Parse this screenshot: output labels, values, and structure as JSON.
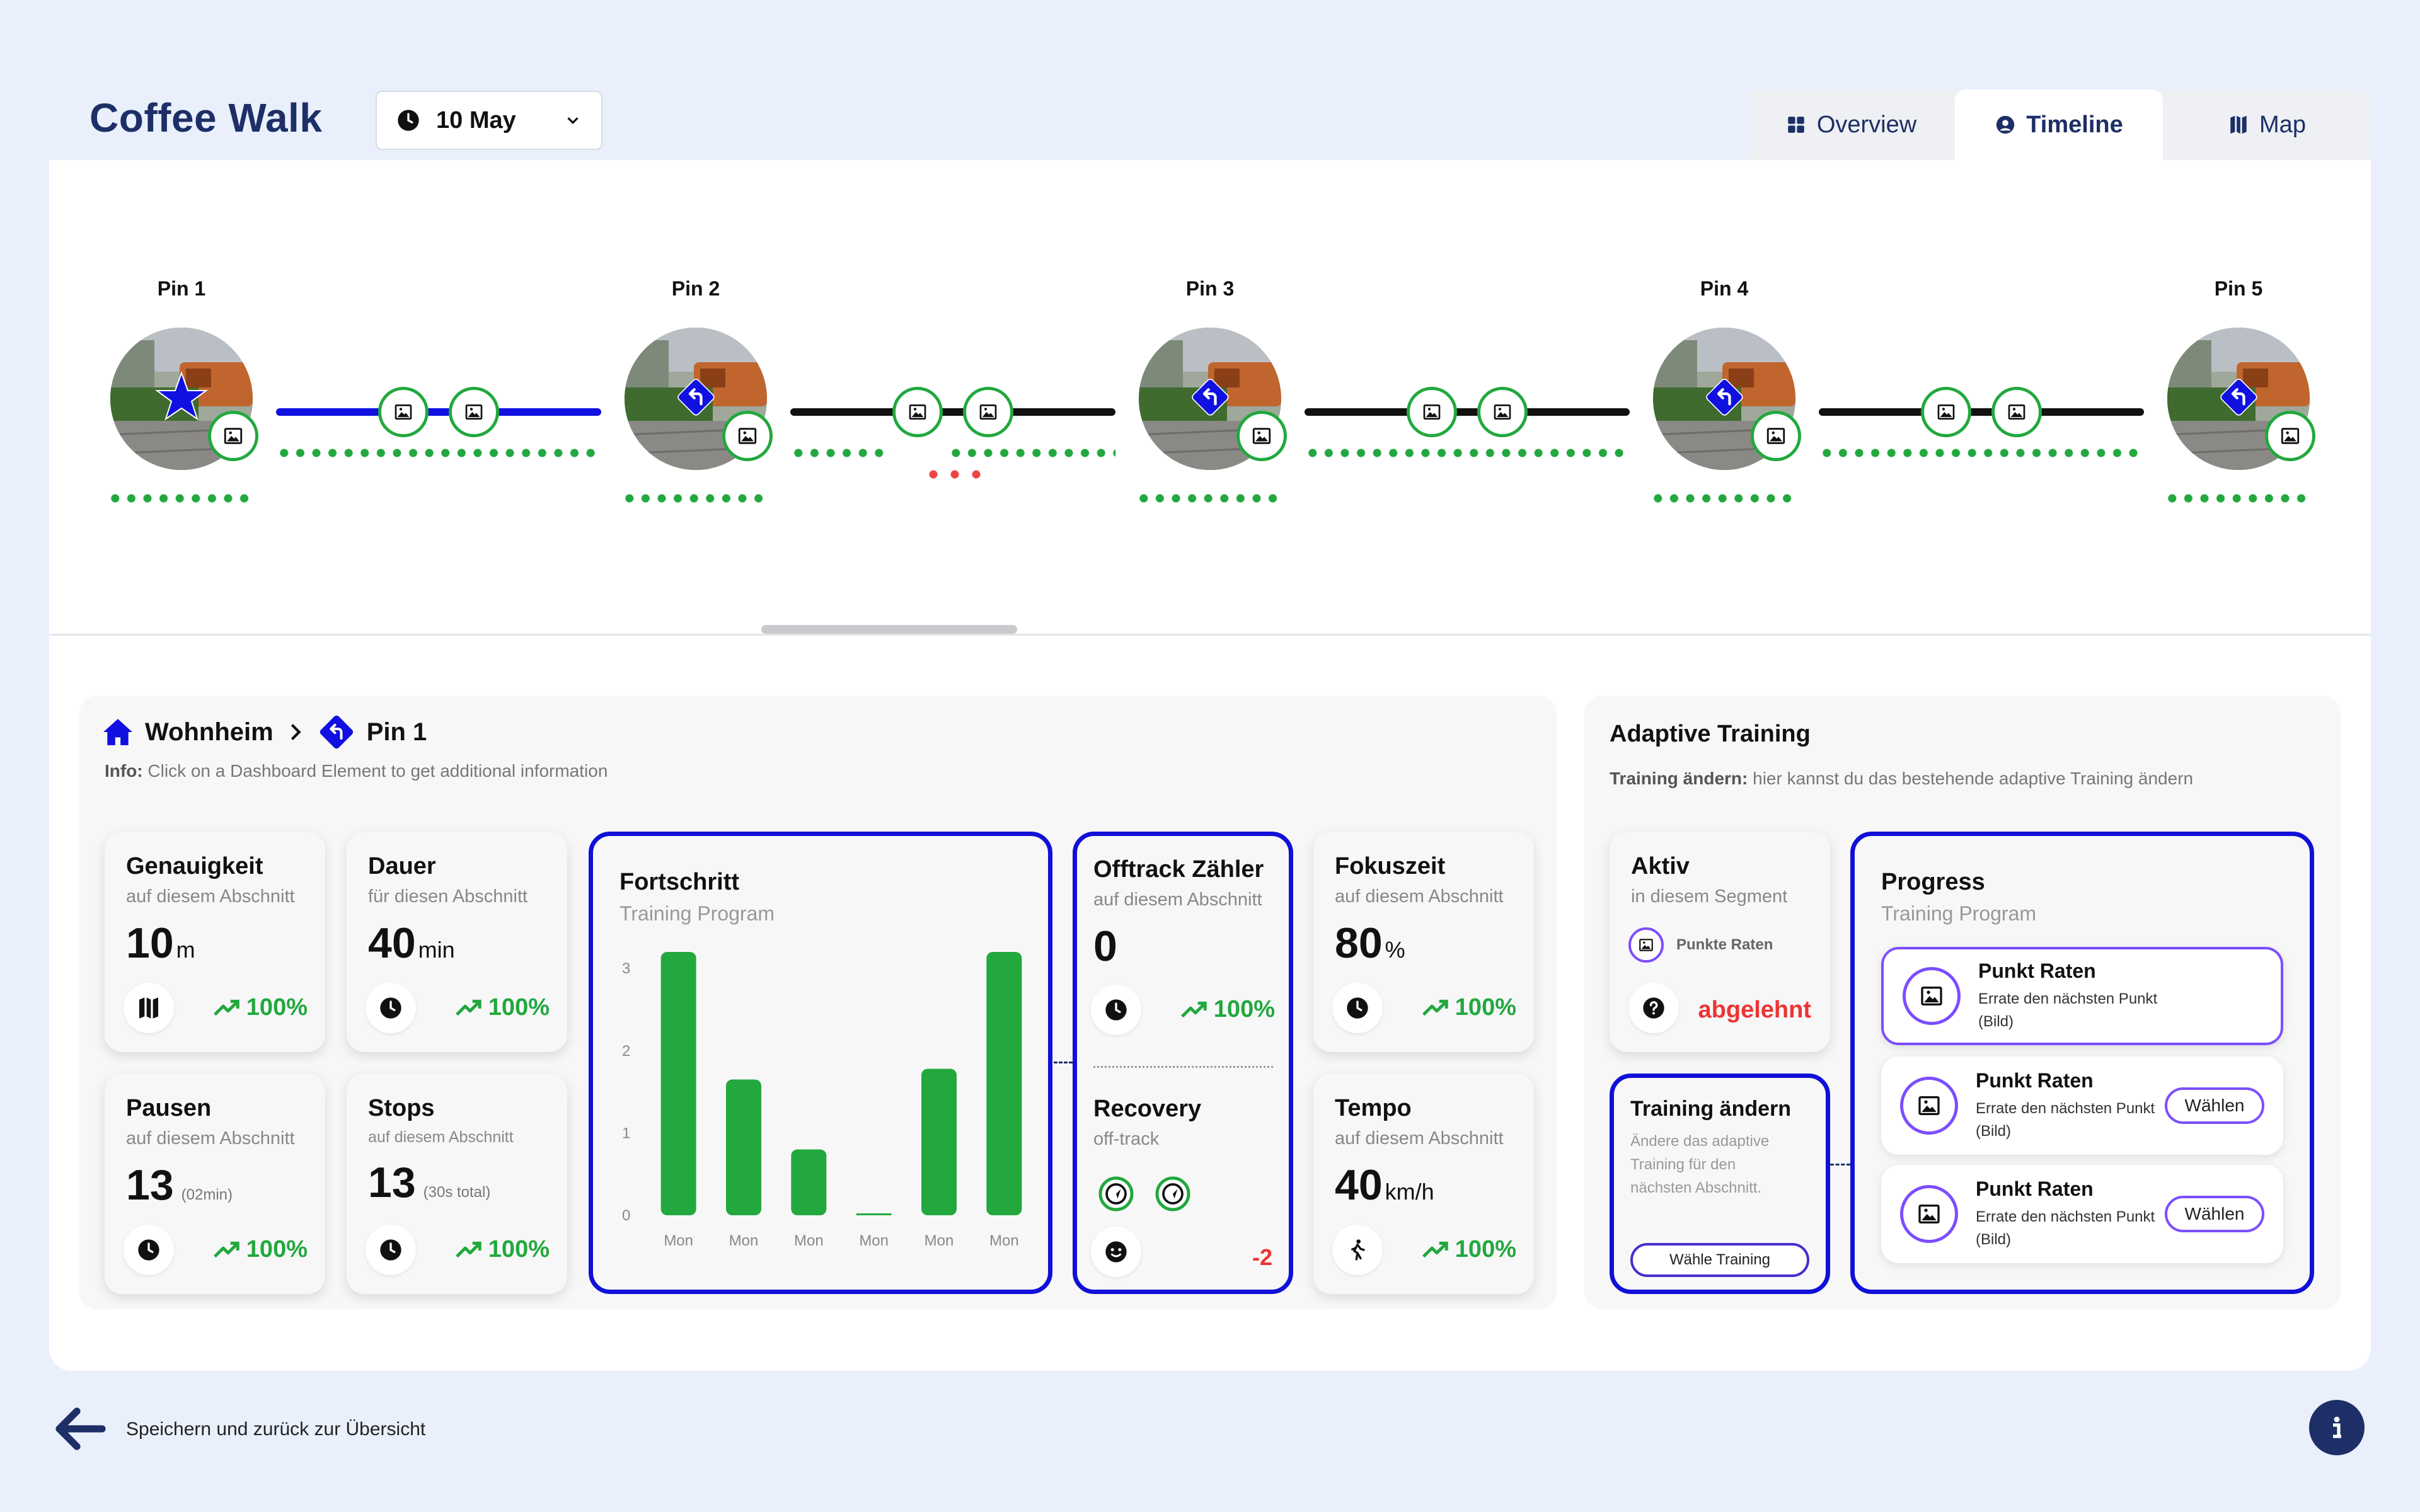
{
  "app": {
    "title": "Coffee Walk"
  },
  "date_picker": {
    "value": "10 May"
  },
  "tabs": [
    {
      "label": "Overview",
      "icon": "grid-icon"
    },
    {
      "label": "Timeline",
      "icon": "user-circle-icon",
      "active": true
    },
    {
      "label": "Map",
      "icon": "map-icon"
    }
  ],
  "timeline": {
    "pins": [
      {
        "label": "Pin 1",
        "marker": "star-icon"
      },
      {
        "label": "Pin 2",
        "marker": "turn-left-icon"
      },
      {
        "label": "Pin 3",
        "marker": "turn-left-icon"
      },
      {
        "label": "Pin 4",
        "marker": "turn-left-icon"
      },
      {
        "label": "Pin 5",
        "marker": "turn-left-icon"
      }
    ],
    "colors": {
      "active_segment": "#1010e0",
      "segment": "#111111",
      "ok": "#22a83e",
      "warn": "#ee4444"
    }
  },
  "breadcrumb": {
    "home": "Wohnheim",
    "current": "Pin 1"
  },
  "info": {
    "label": "Info:",
    "text": "Click on a Dashboard Element to get additional information"
  },
  "stats": {
    "genauigkeit": {
      "title": "Genauigkeit",
      "sub": "auf diesem Abschnitt",
      "value": "10",
      "unit": "m",
      "trend": "100%"
    },
    "dauer": {
      "title": "Dauer",
      "sub": "für diesen Abschnitt",
      "value": "40",
      "unit": "min",
      "trend": "100%"
    },
    "pausen": {
      "title": "Pausen",
      "sub": "auf diesem Abschnitt",
      "value": "13",
      "note": "(02min)",
      "trend": "100%"
    },
    "stops": {
      "title": "Stops",
      "sub": "auf diesem Abschnitt",
      "value": "13",
      "note": "(30s total)",
      "trend": "100%"
    },
    "offtrack": {
      "title": "Offtrack Zähler",
      "sub": "auf diesem Abschnitt",
      "value": "0",
      "trend": "100%"
    },
    "recovery": {
      "title": "Recovery",
      "sub": "off-track",
      "value": "-2"
    },
    "fokuszeit": {
      "title": "Fokuszeit",
      "sub": "auf diesem Abschnitt",
      "value": "80",
      "unit": "%",
      "trend": "100%"
    },
    "tempo": {
      "title": "Tempo",
      "sub": "auf diesem Abschnitt",
      "value": "40",
      "unit": "km/h",
      "trend": "100%"
    }
  },
  "progress_chart": {
    "title": "Fortschritt",
    "subtitle": "Training Program"
  },
  "chart_data": {
    "type": "bar",
    "categories": [
      "Mon",
      "Mon",
      "Mon",
      "Mon",
      "Mon",
      "Mon"
    ],
    "values": [
      3.2,
      1.65,
      0.8,
      0.0,
      1.78,
      3.2
    ],
    "yticks": [
      "0",
      "1",
      "2",
      "3"
    ],
    "ylim": [
      0,
      3.2
    ],
    "color": "#22a83e"
  },
  "adaptive": {
    "title": "Adaptive Training",
    "info_label": "Training ändern:",
    "info_text": "hier kannst du das bestehende adaptive Training ändern",
    "aktiv": {
      "title": "Aktiv",
      "sub": "in diesem Segment",
      "task": "Punkte Raten",
      "status": "abgelehnt"
    },
    "change": {
      "title": "Training ändern",
      "desc": "Ändere das adaptive Training für den nächsten Abschnitt.",
      "button": "Wähle Training"
    },
    "progress": {
      "title": "Progress",
      "subtitle": "Training Program",
      "tasks": [
        {
          "title": "Punkt Raten",
          "desc": "Errate den nächsten Punkt (Bild)",
          "selected": true
        },
        {
          "title": "Punkt Raten",
          "desc": "Errate den nächsten Punkt (Bild)",
          "button": "Wählen"
        },
        {
          "title": "Punkt Raten",
          "desc": "Errate den nächsten Punkt (Bild)",
          "button": "Wählen"
        }
      ]
    }
  },
  "footer": {
    "back_label": "Speichern und zurück zur Übersicht"
  }
}
